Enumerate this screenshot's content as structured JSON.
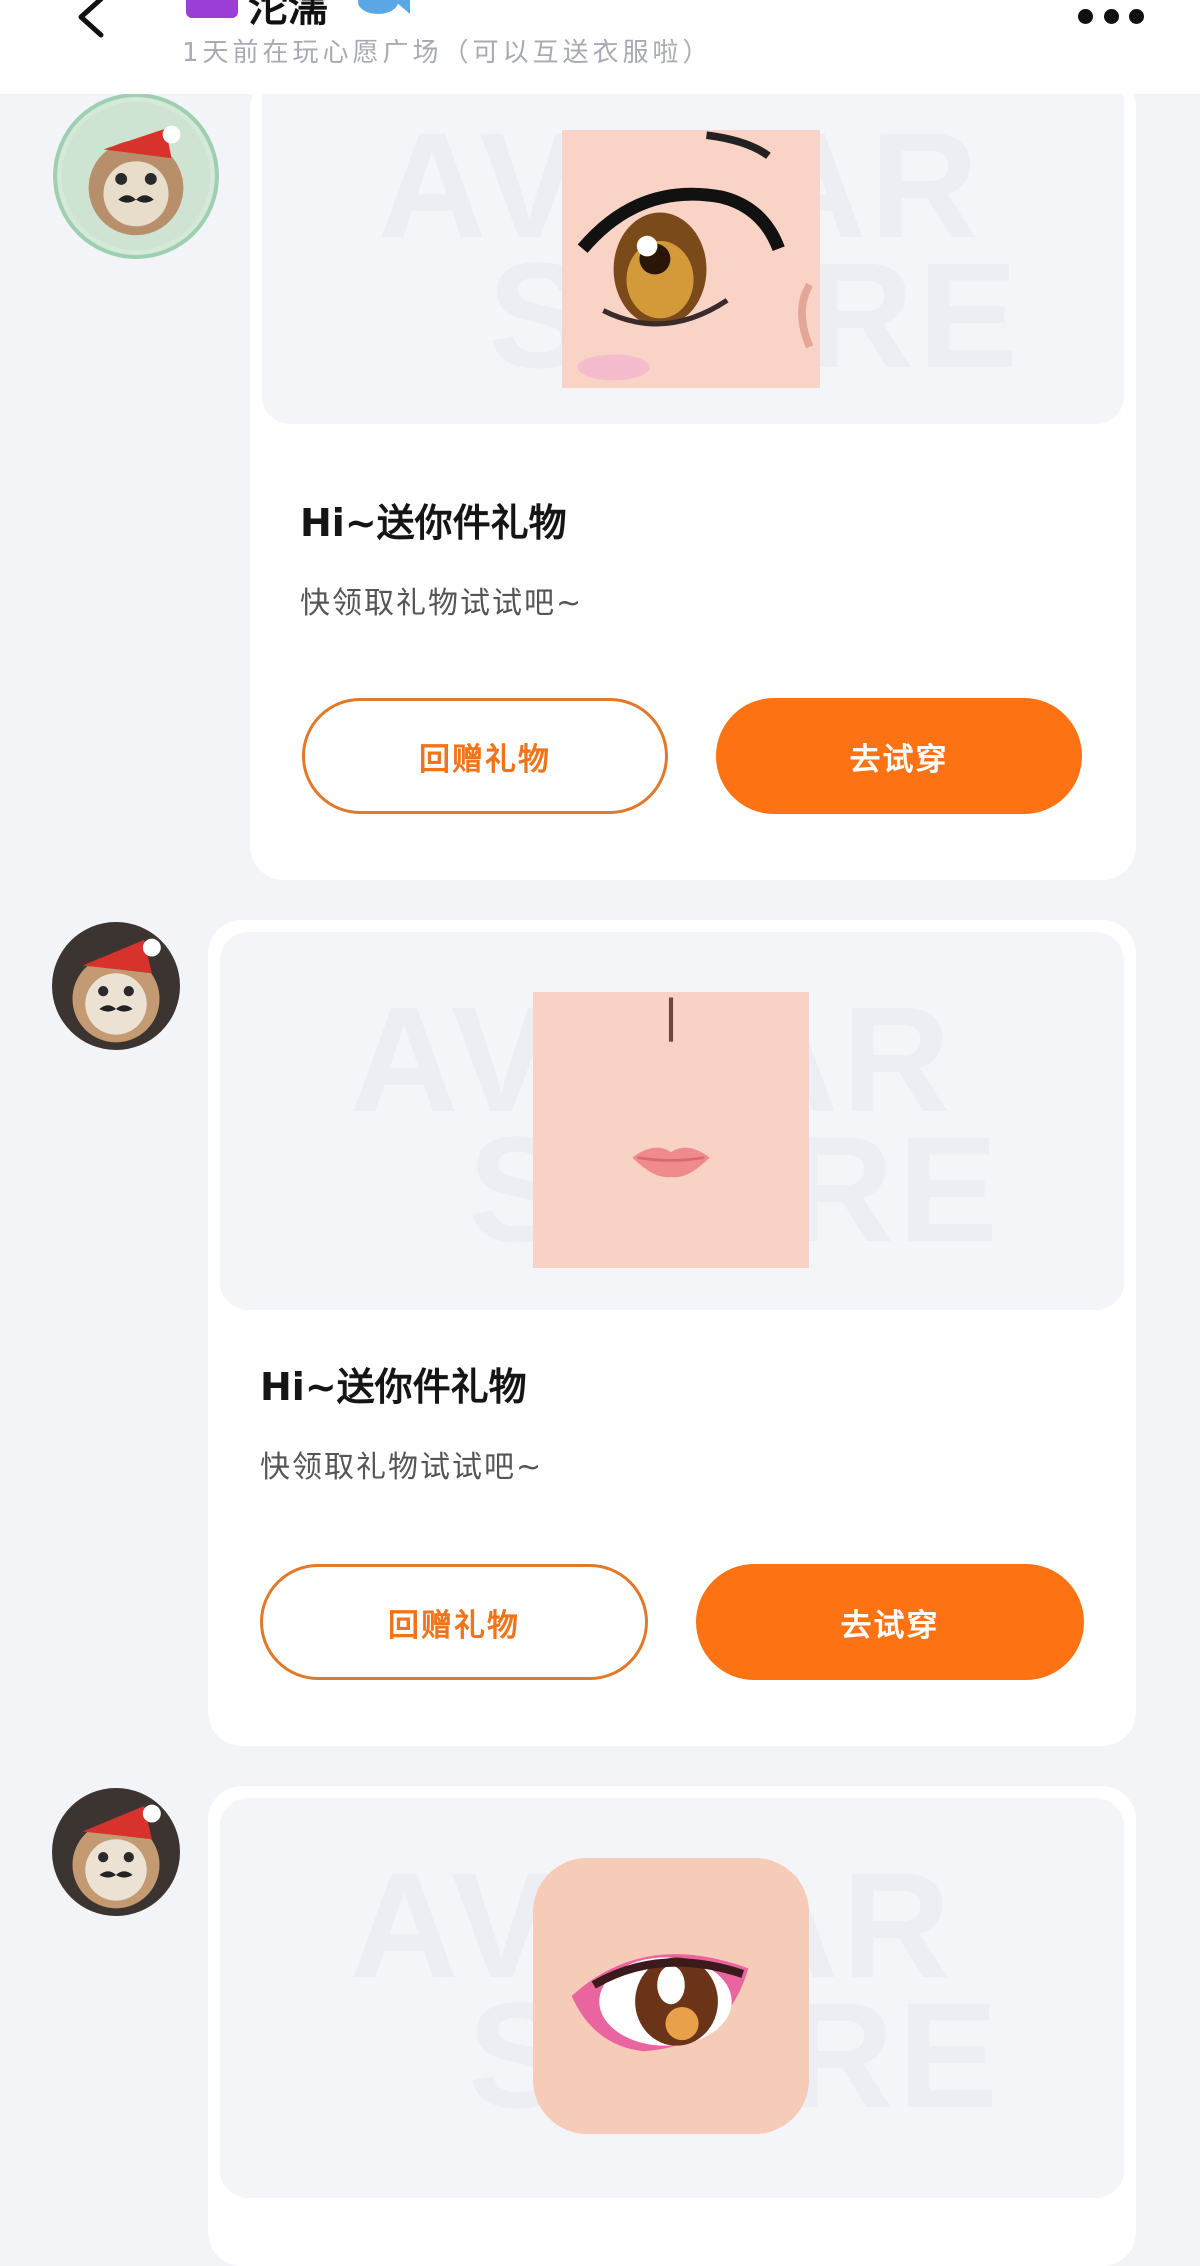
{
  "header": {
    "title": "沱濡",
    "status": "1天前在玩心愿广场（可以互送衣服啦）",
    "back_icon": "chevron-left-icon",
    "more_icon": "ellipsis-icon",
    "id_badge_icon": "id-badge-icon",
    "title_emoji": "fish-icon"
  },
  "messages": [
    {
      "title": "Hi~送你件礼物",
      "description": "快领取礼物试试吧~",
      "secondary_button": "回赠礼物",
      "primary_button": "去试穿",
      "preview_item": "eye-makeup"
    },
    {
      "title": "Hi~送你件礼物",
      "description": "快领取礼物试试吧~",
      "secondary_button": "回赠礼物",
      "primary_button": "去试穿",
      "preview_item": "lips-makeup"
    },
    {
      "preview_item": "eye-makeup-pink"
    }
  ],
  "watermark": {
    "line1": "AVATAR",
    "line2": "STORE"
  },
  "colors": {
    "accent": "#fd7213",
    "background": "#f3f4f8",
    "card": "#ffffff"
  }
}
